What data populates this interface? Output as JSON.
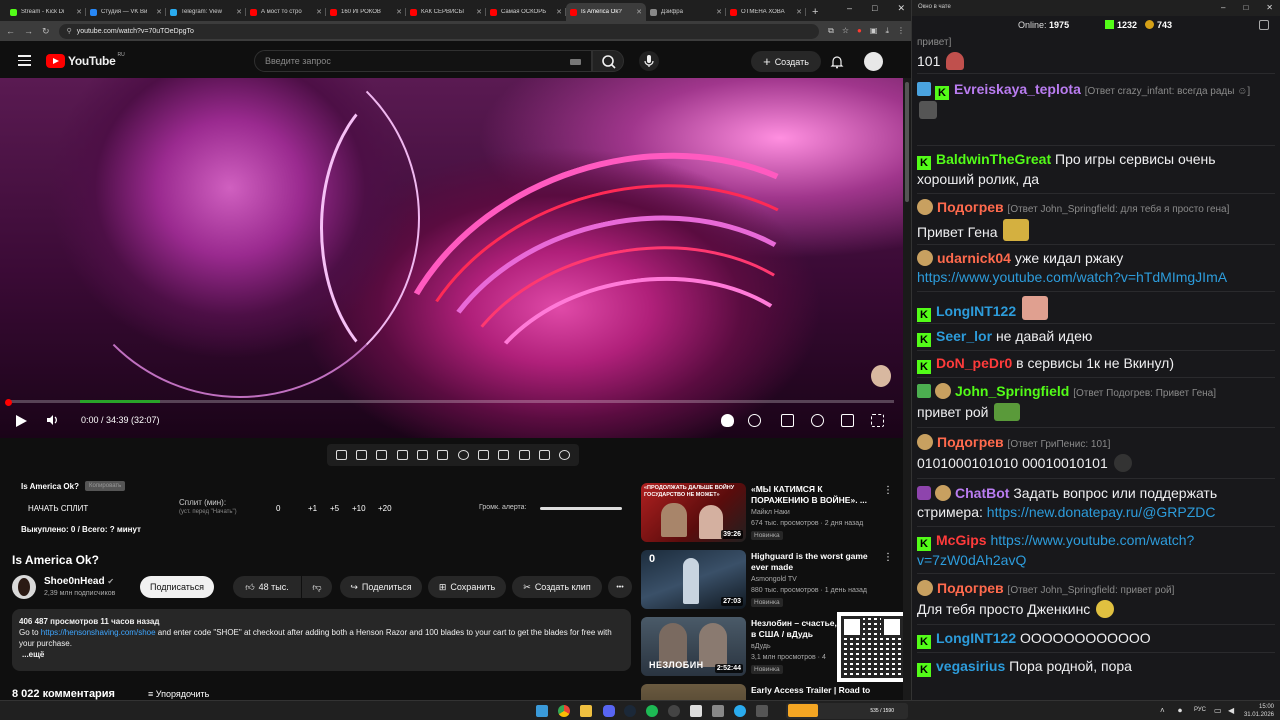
{
  "browser": {
    "tabs": [
      {
        "title": "Stream - Kick Di",
        "color": "#53fc18"
      },
      {
        "title": "Студия — VK Ви",
        "color": "#2787f5"
      },
      {
        "title": "Telegram: View",
        "color": "#2aabee"
      },
      {
        "title": "А мост то стро",
        "color": "#ff0000"
      },
      {
        "title": "160 ИГРОКОВ",
        "color": "#ff0000"
      },
      {
        "title": "КАК СЕРВИСЫ",
        "color": "#ff0000"
      },
      {
        "title": "Самая ОСКОРБ",
        "color": "#ff0000"
      },
      {
        "title": "Is America Ok?",
        "color": "#ff0000"
      },
      {
        "title": "Дзифра",
        "color": "#888888"
      },
      {
        "title": "ОТМЕНА ХОВА",
        "color": "#ff0000"
      }
    ],
    "active_tab_index": 7,
    "new_tab_symbol": "+",
    "window_controls": [
      "–",
      "□",
      "✕"
    ],
    "url": "youtube.com/watch?v=70uTOeDpgTo"
  },
  "youtube": {
    "logo_text": "YouTube",
    "region": "RU",
    "search_placeholder": "Введите запрос",
    "create_label": "Создать",
    "player": {
      "time": "0:00 / 34:39 (32:07)",
      "progress_fraction": 0.002,
      "buffer_fraction": 0.09
    },
    "split_panel": {
      "title": "Is America Ok?",
      "copy_label": "Копировать",
      "start_label": "НАЧАТЬ СПЛИТ",
      "split_label": "Сплит (мин):",
      "split_hint": "(уст. перед \"Начать\")",
      "values": [
        "0",
        "+1",
        "+5",
        "+10",
        "+20"
      ],
      "alert_label": "Громк. алерта:",
      "bought": "Выкуплено: 0 / Всего: ? минут"
    },
    "video": {
      "title": "Is America Ok?",
      "channel": "Shoe0nHead",
      "subscribers": "2,39 млн подписчиков",
      "subscribe_label": "Подписаться",
      "likes": "48 тыс.",
      "share_label": "Поделиться",
      "save_label": "Сохранить",
      "clip_label": "Создать клип",
      "more_label": "•••",
      "desc_stats": "406 487 просмотров  11 часов назад",
      "desc_pre": "Go to ",
      "desc_link": "https://hensonshaving.com/shoe",
      "desc_post": " and enter code \"SHOE\" at checkout after adding both a Henson Razor and 100 blades to your cart to get the blades for free with your purchase.",
      "desc_more": "...ещё",
      "comments_count": "8 022 комментария",
      "sort_label": "Упорядочить"
    },
    "recommendations": [
      {
        "title": "«МЫ КАТИМСЯ К ПОРАЖЕНИЮ В ВОЙНЕ». ...",
        "channel": "Майкл Наки",
        "views": "674 тыс. просмотров · 2 дня назад",
        "badge": "Новинка",
        "duration": "39:26",
        "thumb_text": "«ПРОДОЛЖАТЬ ДАЛЬШЕ ВОЙНУ ГОСУДАРСТВО НЕ МОЖЕТ»"
      },
      {
        "title": "Highguard is the worst game ever made",
        "channel": "Asmongold TV",
        "views": "880 тыс. просмотров · 1 день назад",
        "badge": "Новинка",
        "duration": "27:03",
        "thumb_text": "0"
      },
      {
        "title": "Незлобин – счастье, цензура в США / вДудь",
        "channel": "вДудь",
        "views": "3,1 млн просмотров · 4",
        "badge": "Новинка",
        "duration": "2:52:44",
        "thumb_text": "НЕЗЛОБИН"
      },
      {
        "title": "Early Access Trailer | Road to",
        "channel": "",
        "views": "",
        "badge": "",
        "duration": "",
        "thumb_text": ""
      }
    ],
    "menu_dots": "⋮"
  },
  "chat": {
    "window_title": "Окно в чате",
    "online_label": "Online:",
    "online_count": "1975",
    "kick_count": "1232",
    "gold_count": "743",
    "messages": [
      {
        "user": "",
        "reply": "привет]",
        "text": "101",
        "color": "#efeff1"
      },
      {
        "user": "Evreiskaya_teplota",
        "reply": "[Ответ crazy_infant: всегда рады ☺]",
        "text": "",
        "color": "#b97cf0"
      },
      {
        "user": "BaldwinTheGreat",
        "reply": "",
        "text": "Про игры сервисы очень хороший ролик, да",
        "color": "#53fc18"
      },
      {
        "user": "Подогрев",
        "reply": "[Ответ John_Springfield: для тебя я просто гена]",
        "text": "Привет Гена",
        "color": "#ff6a4d"
      },
      {
        "user": "udarnick04",
        "reply": "",
        "text": "уже кидал ржаку",
        "link": "https://www.youtube.com/watch?v=hTdMImgJImA",
        "color": "#ff6a4d"
      },
      {
        "user": "LongINT122",
        "reply": "",
        "text": "",
        "color": "#2d9cdb"
      },
      {
        "user": "Seer_lor",
        "reply": "",
        "text": "не давай идею",
        "color": "#2d9cdb"
      },
      {
        "user": "DoN_peDr0",
        "reply": "",
        "text": "в сервисы 1к не Вкинул)",
        "color": "#ff3b3b"
      },
      {
        "user": "John_Springfield",
        "reply": "[Ответ Подогрев: Привет Гена]",
        "text": "привет рой",
        "color": "#53fc18"
      },
      {
        "user": "Подогрев",
        "reply": "[Ответ ГриПенис: 101]",
        "text": "0101000101010 00010010101",
        "color": "#ff6a4d"
      },
      {
        "user": "ChatBot",
        "reply": "",
        "text": "Задать вопрос или поддержать стримера:",
        "link": "https://new.donatepay.ru/@GRPZDC",
        "color": "#b97cf0"
      },
      {
        "user": "McGips",
        "reply": "",
        "text": "",
        "link": "https://www.youtube.com/watch?v=7zW0dAh2avQ",
        "color": "#ff3b3b"
      },
      {
        "user": "Подогрев",
        "reply": "[Ответ John_Springfield: привет рой]",
        "text": "Для тебя просто Дженкинс",
        "color": "#ff6a4d"
      },
      {
        "user": "LongINT122",
        "reply": "",
        "text": "ОООООООООООО",
        "color": "#2d9cdb"
      },
      {
        "user": "vegasirius",
        "reply": "",
        "text": "Пора родной, пора",
        "color": "#2d9cdb"
      }
    ]
  },
  "taskbar": {
    "lang": "РУС",
    "time": "15:00",
    "date": "31.01.2026",
    "widget_text": "535 / 1590"
  }
}
